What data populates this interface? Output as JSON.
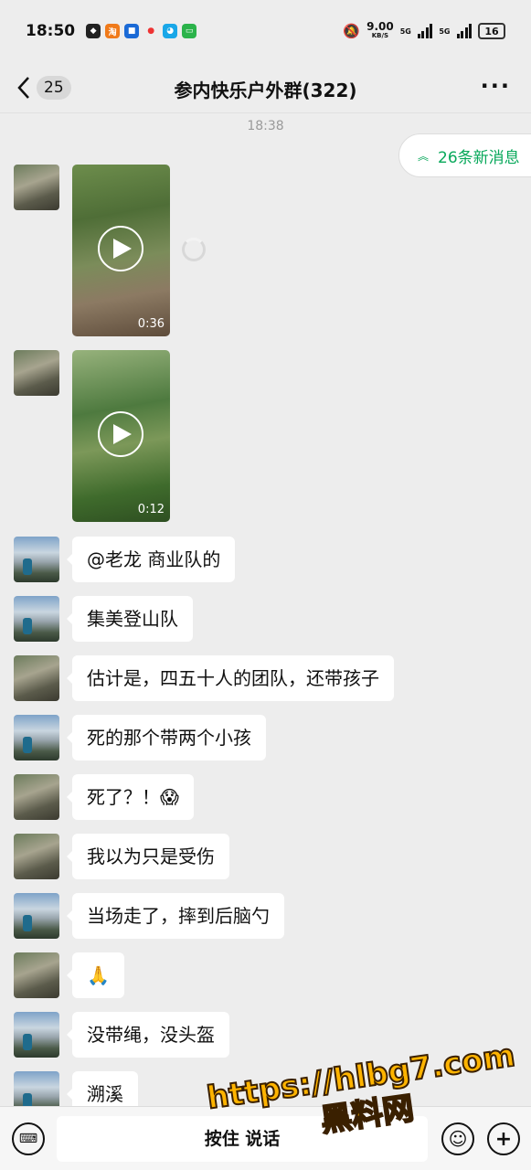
{
  "status": {
    "time": "18:50",
    "speed_value": "9.00",
    "speed_unit": "KB/S",
    "net1": "5G",
    "net2": "5G",
    "battery": "16"
  },
  "nav": {
    "back_count": "25",
    "title": "参内快乐户外群(322)",
    "more": "···"
  },
  "chat": {
    "timestamp": "18:38",
    "new_messages": "26条新消息",
    "videos": [
      {
        "duration": "0:36"
      },
      {
        "duration": "0:12"
      }
    ],
    "messages": [
      "@老龙  商业队的",
      "集美登山队",
      "估计是，四五十人的团队，还带孩子",
      "死的那个带两个小孩",
      "死了？！😱",
      "我以为只是受伤",
      "当场走了，摔到后脑勺",
      "🙏",
      "没带绳，没头盔",
      "溯溪"
    ]
  },
  "bottom": {
    "hold_to_talk": "按住 说话"
  },
  "watermark": {
    "line1": "https://hlbg7.com",
    "line2": "黑料网"
  }
}
